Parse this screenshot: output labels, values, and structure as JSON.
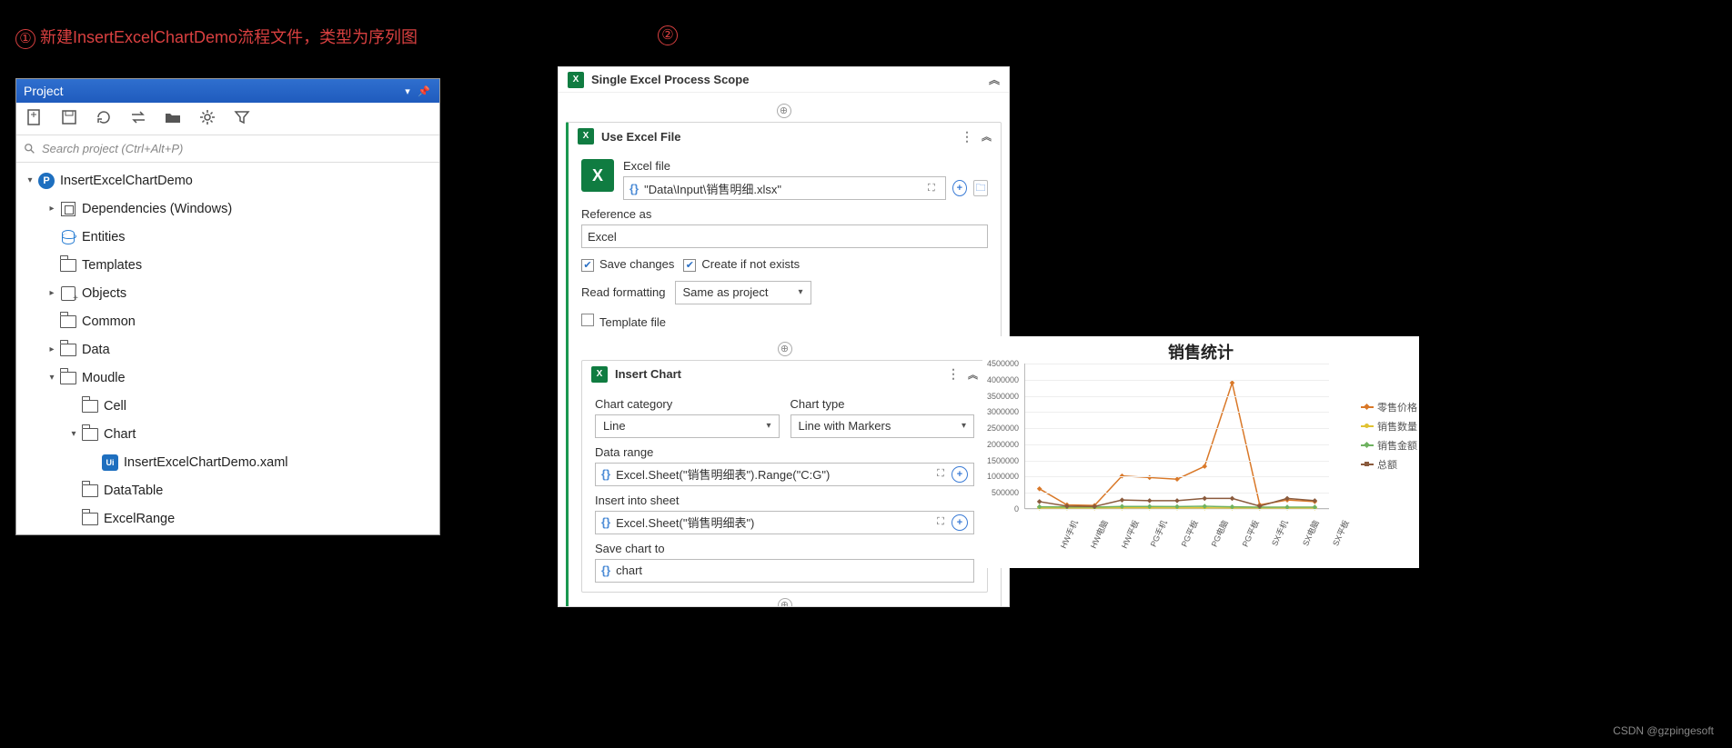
{
  "annot": {
    "step1": "新建InsertExcelChartDemo流程文件，类型为序列图",
    "num1": "①",
    "num2": "②"
  },
  "project": {
    "title": "Project",
    "search_placeholder": "Search project (Ctrl+Alt+P)",
    "root": "InsertExcelChartDemo",
    "items": {
      "deps": "Dependencies (Windows)",
      "entities": "Entities",
      "templates": "Templates",
      "objects": "Objects",
      "common": "Common",
      "data": "Data",
      "moudle": "Moudle",
      "cell": "Cell",
      "chart": "Chart",
      "xaml": "InsertExcelChartDemo.xaml",
      "datatable": "DataTable",
      "excelrange": "ExcelRange"
    }
  },
  "wf": {
    "scope_title": "Single Excel Process Scope",
    "use_excel": {
      "title": "Use Excel File",
      "file_label": "Excel file",
      "file_value": "\"Data\\Input\\销售明细.xlsx\"",
      "ref_label": "Reference as",
      "ref_value": "Excel",
      "save_changes": "Save changes",
      "create_if": "Create if not exists",
      "read_fmt_label": "Read formatting",
      "read_fmt_value": "Same as project",
      "template_file": "Template file"
    },
    "insert_chart": {
      "title": "Insert Chart",
      "cat_label": "Chart category",
      "cat_value": "Line",
      "type_label": "Chart type",
      "type_value": "Line with Markers",
      "range_label": "Data range",
      "range_value": "Excel.Sheet(\"销售明细表\").Range(\"C:G\")",
      "sheet_label": "Insert into sheet",
      "sheet_value": "Excel.Sheet(\"销售明细表\")",
      "save_label": "Save chart to",
      "save_value": "chart"
    }
  },
  "chart_data": {
    "type": "line",
    "title": "销售统计",
    "ylabel": "",
    "ylim": [
      0,
      4500000
    ],
    "yticks": [
      0,
      500000,
      1000000,
      1500000,
      2000000,
      2500000,
      3000000,
      3500000,
      4000000,
      4500000
    ],
    "categories": [
      "HW手机",
      "HW电脑",
      "HW平板",
      "PG手机",
      "PG平板",
      "PG电脑",
      "PG平板",
      "SX手机",
      "SX电脑",
      "SX平板"
    ],
    "series": [
      {
        "name": "零售价格",
        "color": "#d97828",
        "values": [
          600000,
          100000,
          80000,
          1000000,
          950000,
          900000,
          1300000,
          3900000,
          100000,
          250000,
          200000
        ]
      },
      {
        "name": "销售数量",
        "color": "#e0c233",
        "values": [
          5000,
          4000,
          3500,
          6000,
          5500,
          5000,
          6000,
          4000,
          3000,
          3500,
          3500
        ]
      },
      {
        "name": "销售金额",
        "color": "#6fb261",
        "values": [
          40000,
          35000,
          30000,
          50000,
          48000,
          45000,
          55000,
          38000,
          28000,
          30000,
          30000
        ]
      },
      {
        "name": "总额",
        "color": "#8a5a3c",
        "values": [
          200000,
          60000,
          50000,
          250000,
          230000,
          230000,
          300000,
          300000,
          60000,
          300000,
          230000
        ]
      }
    ],
    "legend_labels": [
      "零售价格",
      "销售数量",
      "销售金额",
      "总额"
    ]
  },
  "watermark": "CSDN @gzpingesoft"
}
